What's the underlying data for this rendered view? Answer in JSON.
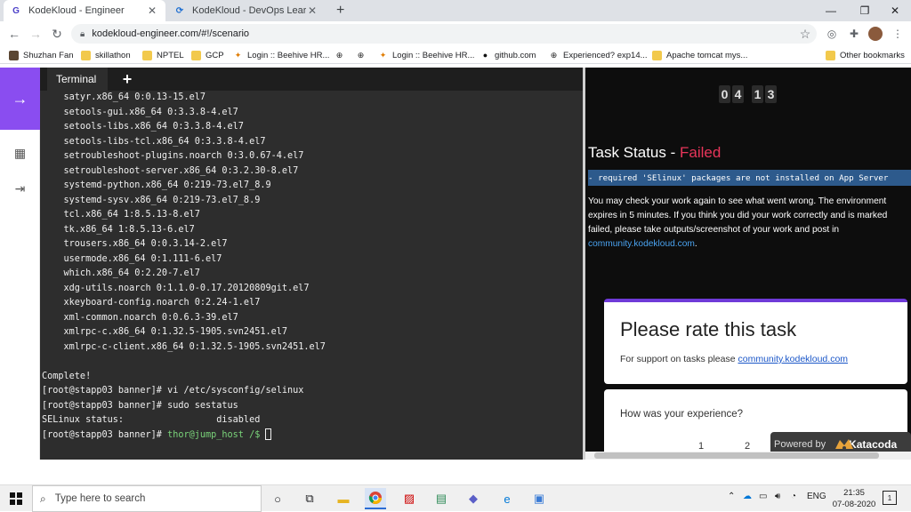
{
  "browser": {
    "tabs": [
      {
        "title": "KodeKloud - Engineer",
        "favicon": "G"
      },
      {
        "title": "KodeKloud - DevOps Learning C",
        "favicon": "kodekloud-icon"
      }
    ],
    "url": "kodekloud-engineer.com/#!/scenario",
    "bookmarks": [
      "Shuzhan Fan",
      "skillathon",
      "NPTEL",
      "GCP",
      "Login :: Beehive HR...",
      "Login :: Beehive HR...",
      "github.com",
      "Experienced? exp14...",
      "Apache tomcat mys...",
      "Other bookmarks"
    ]
  },
  "terminal": {
    "tab_label": "Terminal",
    "lines": [
      "    satyr.x86_64 0:0.13-15.el7",
      "    setools-gui.x86_64 0:3.3.8-4.el7",
      "    setools-libs.x86_64 0:3.3.8-4.el7",
      "    setools-libs-tcl.x86_64 0:3.3.8-4.el7",
      "    setroubleshoot-plugins.noarch 0:3.0.67-4.el7",
      "    setroubleshoot-server.x86_64 0:3.2.30-8.el7",
      "    systemd-python.x86_64 0:219-73.el7_8.9",
      "    systemd-sysv.x86_64 0:219-73.el7_8.9",
      "    tcl.x86_64 1:8.5.13-8.el7",
      "    tk.x86_64 1:8.5.13-6.el7",
      "    trousers.x86_64 0:0.3.14-2.el7",
      "    usermode.x86_64 0:1.111-6.el7",
      "    which.x86_64 0:2.20-7.el7",
      "    xdg-utils.noarch 0:1.1.0-0.17.20120809git.el7",
      "    xkeyboard-config.noarch 0:2.24-1.el7",
      "    xml-common.noarch 0:0.6.3-39.el7",
      "    xmlrpc-c.x86_64 0:1.32.5-1905.svn2451.el7",
      "    xmlrpc-c-client.x86_64 0:1.32.5-1905.svn2451.el7",
      "",
      "Complete!",
      "[root@stapp03 banner]# vi /etc/sysconfig/selinux",
      "[root@stapp03 banner]# sudo sestatus",
      "SELinux status:                 disabled"
    ],
    "last_prompt": "[root@stapp03 banner]# ",
    "last_prompt_green": "thor@jump_host /$ "
  },
  "task": {
    "timer": [
      "0",
      "4",
      "1",
      "3"
    ],
    "status_label": "Task Status - ",
    "status_value": "Failed",
    "message": "- required 'SElinux' packages are not installed on App Server",
    "body": "You may check your work again to see what went wrong. The environment expires in 5 minutes. If you think you did your work correctly and is marked failed, please take outputs/screenshot of your work and post in ",
    "body_link": "community.kodekloud.com",
    "body_end": ".",
    "rate_title": "Please rate this task",
    "rate_support": "For support on tasks please ",
    "rate_support_link": "community.kodekloud.com",
    "experience_question": "How was your experience?",
    "rating_options": [
      "1",
      "2"
    ],
    "powered_by": "Powered by",
    "powered_brand": "Katacoda"
  },
  "taskbar": {
    "search_placeholder": "Type here to search",
    "language": "ENG",
    "time": "21:35",
    "date": "07-08-2020",
    "notification_count": "1"
  }
}
